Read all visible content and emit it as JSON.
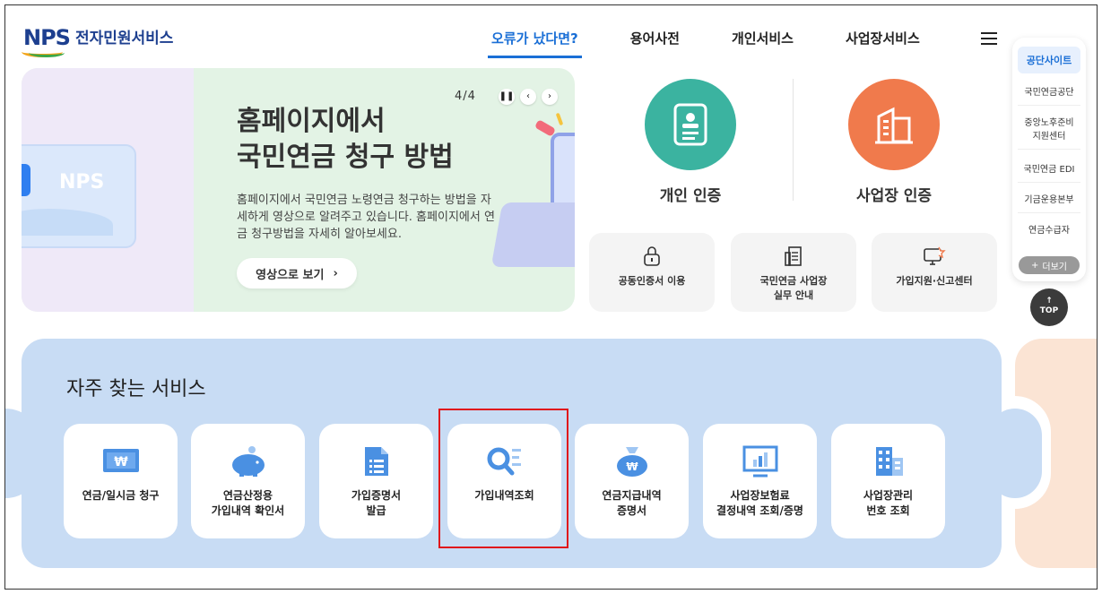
{
  "header": {
    "logo_mark": "NPS",
    "logo_text": "전자민원서비스",
    "nav": [
      "오류가 났다면?",
      "용어사전",
      "개인서비스",
      "사업장서비스"
    ],
    "menu_icon": "hamburger-icon"
  },
  "banner": {
    "pager": "4/4",
    "title": "홈페이지에서\n국민연금 청구 방법",
    "description": "홈페이지에서 국민연금 노령연금 청구하는 방법을 자세하게 영상으로 알려주고 있습니다. 홈페이지에서 연금 청구방법을 자세히 알아보세요.",
    "button_label": "영상으로 보기",
    "card_logo": "NPS"
  },
  "certs": [
    {
      "label": "개인 인증",
      "color": "#3bb3a0",
      "icon": "id-card-icon"
    },
    {
      "label": "사업장 인증",
      "color": "#f07a4c",
      "icon": "building-icon"
    }
  ],
  "quick_links": [
    {
      "label": "공동인증서 이용",
      "icon": "lock-icon"
    },
    {
      "label": "국민연금 사업장\n실무 안내",
      "icon": "document-icon"
    },
    {
      "label": "가입지원·신고센터",
      "icon": "monitor-report-icon"
    }
  ],
  "sidebar": {
    "head": "공단사이트",
    "items": [
      "국민연금공단",
      "중앙노후준비\n지원센터",
      "국민연금 EDI",
      "기금운용본부",
      "연금수급자"
    ],
    "more": "더보기",
    "top": "TOP"
  },
  "frequent": {
    "title": "자주 찾는 서비스",
    "items": [
      {
        "label": "연금/일시금 청구",
        "icon": "won-card-icon"
      },
      {
        "label": "연금산정용\n가입내역 확인서",
        "icon": "piggy-bank-icon"
      },
      {
        "label": "가입증명서\n발급",
        "icon": "certificate-file-icon"
      },
      {
        "label": "가입내역조회",
        "icon": "search-list-icon"
      },
      {
        "label": "연금지급내역\n증명서",
        "icon": "money-bag-icon"
      },
      {
        "label": "사업장보험료\n결정내역 조회/증명",
        "icon": "chart-monitor-icon"
      },
      {
        "label": "사업장관리\n번호 조회",
        "icon": "buildings-icon"
      }
    ]
  },
  "colors": {
    "accent": "#1a6fd6",
    "service_bg": "#c8dcf4",
    "highlight": "#e0161b"
  }
}
